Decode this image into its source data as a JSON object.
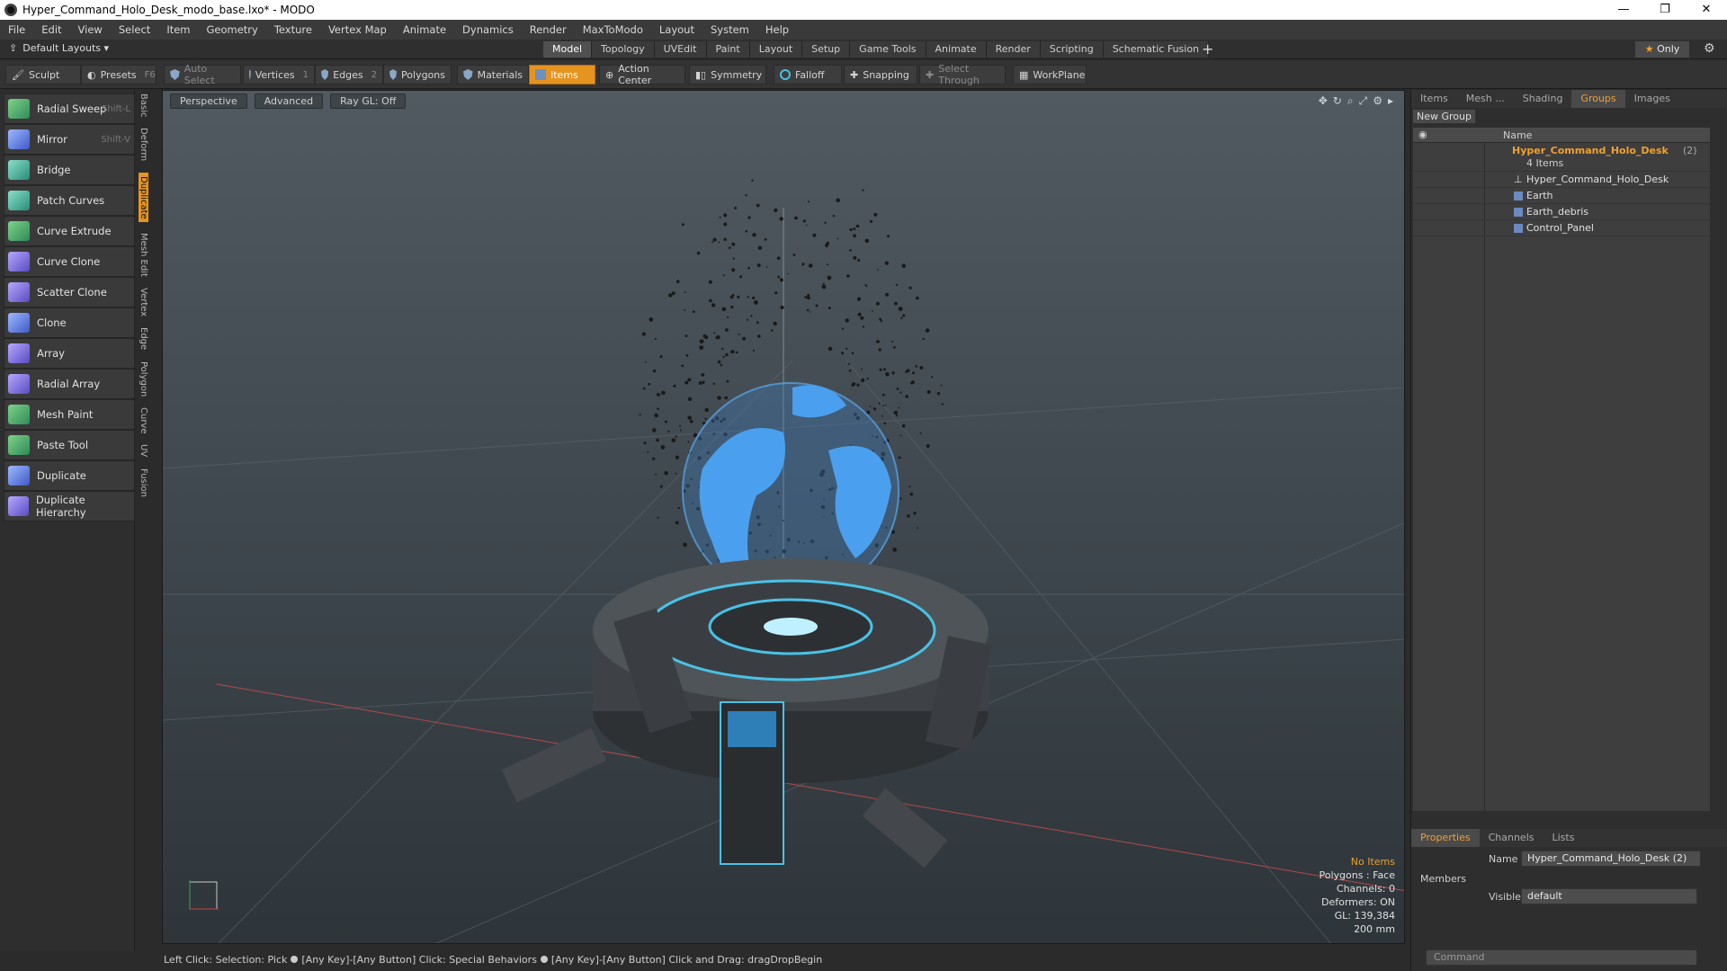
{
  "window": {
    "title": "Hyper_Command_Holo_Desk_modo_base.lxo* - MODO",
    "controls": [
      "—",
      "❐",
      "✕"
    ]
  },
  "menu": [
    "File",
    "Edit",
    "View",
    "Select",
    "Item",
    "Geometry",
    "Texture",
    "Vertex Map",
    "Animate",
    "Dynamics",
    "Render",
    "MaxToModo",
    "Layout",
    "System",
    "Help"
  ],
  "layout_bar": {
    "layouts_label": "Default Layouts ▾",
    "tabs": [
      "Model",
      "Topology",
      "UVEdit",
      "Paint",
      "Layout",
      "Setup",
      "Game Tools",
      "Animate",
      "Render",
      "Scripting",
      "Schematic Fusion"
    ],
    "active_tab": "Model",
    "plus": "+",
    "only_label": "Only"
  },
  "toolbar": {
    "sculpt": "Sculpt",
    "presets": "Presets",
    "presets_key": "F6",
    "auto_select": "Auto Select",
    "vertices": "Vertices",
    "vertices_count": "1",
    "edges": "Edges",
    "edges_count": "2",
    "polygons": "Polygons",
    "materials": "Materials",
    "items": "Items",
    "action_center": "Action Center",
    "symmetry": "Symmetry",
    "falloff": "Falloff",
    "snapping": "Snapping",
    "select_through": "Select Through",
    "workplane": "WorkPlane"
  },
  "tools": [
    {
      "label": "Radial Sweep",
      "key": "Shift-L",
      "icon": "radial-sweep-icon"
    },
    {
      "label": "Mirror",
      "key": "Shift-V",
      "icon": "mirror-icon"
    },
    {
      "label": "Bridge",
      "key": "",
      "icon": "bridge-icon"
    },
    {
      "label": "Patch Curves",
      "key": "",
      "icon": "patch-curves-icon"
    },
    {
      "label": "Curve Extrude",
      "key": "",
      "icon": "curve-extrude-icon"
    },
    {
      "label": "Curve Clone",
      "key": "",
      "icon": "curve-clone-icon"
    },
    {
      "label": "Scatter Clone",
      "key": "",
      "icon": "scatter-clone-icon"
    },
    {
      "label": "Clone",
      "key": "",
      "icon": "clone-icon"
    },
    {
      "label": "Array",
      "key": "",
      "icon": "array-icon"
    },
    {
      "label": "Radial Array",
      "key": "",
      "icon": "radial-array-icon"
    },
    {
      "label": "Mesh Paint",
      "key": "",
      "icon": "mesh-paint-icon"
    },
    {
      "label": "Paste Tool",
      "key": "",
      "icon": "paste-tool-icon"
    },
    {
      "label": "Duplicate",
      "key": "",
      "icon": "duplicate-icon"
    },
    {
      "label": "Duplicate Hierarchy",
      "key": "",
      "icon": "duplicate-hierarchy-icon"
    }
  ],
  "vertical_tabs": [
    "Basic",
    "Deform",
    "Duplicate",
    "Mesh Edit",
    "Vertex",
    "Edge",
    "Polygon",
    "Curve",
    "UV",
    "Fusion"
  ],
  "vertical_tab_active": "Duplicate",
  "viewport": {
    "view_mode": "Perspective",
    "shading": "Advanced",
    "raygl": "Ray GL: Off",
    "stats": {
      "no_items": "No Items",
      "polygons": "Polygons : Face",
      "channels": "Channels: 0",
      "deformers": "Deformers: ON",
      "gl": "GL: 139,384",
      "scale": "200 mm"
    }
  },
  "status_bar": {
    "part1": "Left Click: Selection: Pick",
    "part2": "[Any Key]-[Any Button] Click: Special Behaviors",
    "part3": "[Any Key]-[Any Button] Click and Drag: dragDropBegin"
  },
  "right_panel": {
    "tabs": [
      "Items",
      "Mesh ...",
      "Shading",
      "Groups",
      "Images"
    ],
    "active_tab": "Groups",
    "new_group": "New Group",
    "column_name": "Name",
    "group": {
      "name": "Hyper_Command_Holo_Desk",
      "count": "(2)",
      "items_label": "4 Items"
    },
    "children": [
      "Hyper_Command_Holo_Desk",
      "Earth",
      "Earth_debris",
      "Control_Panel"
    ],
    "props_tabs": [
      "Properties",
      "Channels",
      "Lists"
    ],
    "props_active": "Properties",
    "name_label": "Name",
    "name_value": "Hyper_Command_Holo_Desk (2)",
    "members_label": "Members",
    "visible_label": "Visible",
    "visible_value": "default",
    "command_placeholder": "Command"
  },
  "colors": {
    "accent": "#e69420",
    "hologram": "#4a9ee8",
    "viewport_top": "#515a61"
  }
}
